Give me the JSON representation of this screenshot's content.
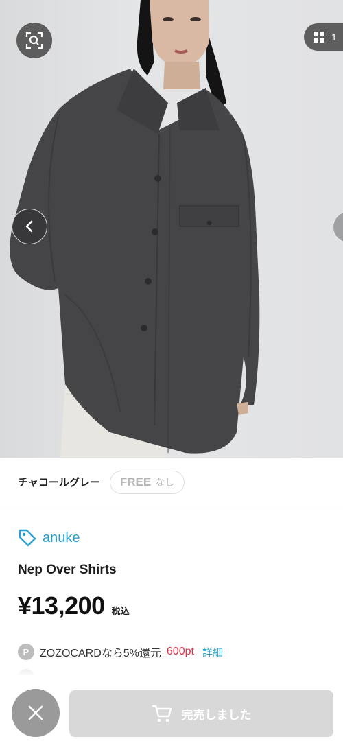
{
  "gallery": {
    "page_count": "1"
  },
  "variant": {
    "color_name": "チャコールグレー",
    "size": "FREE",
    "stock_status": "なし"
  },
  "product": {
    "brand": "anuke",
    "name": "Nep Over Shirts",
    "price": "¥13,200",
    "tax_label": "税込"
  },
  "points": {
    "badge": "P",
    "text": "ZOZOCARDなら5%還元",
    "value": "600pt",
    "link": "詳細"
  },
  "actions": {
    "soldout_label": "完売しました"
  },
  "colors": {
    "accent": "#2aa0d0",
    "point_red": "#e0344a",
    "shirt": "#454547"
  }
}
